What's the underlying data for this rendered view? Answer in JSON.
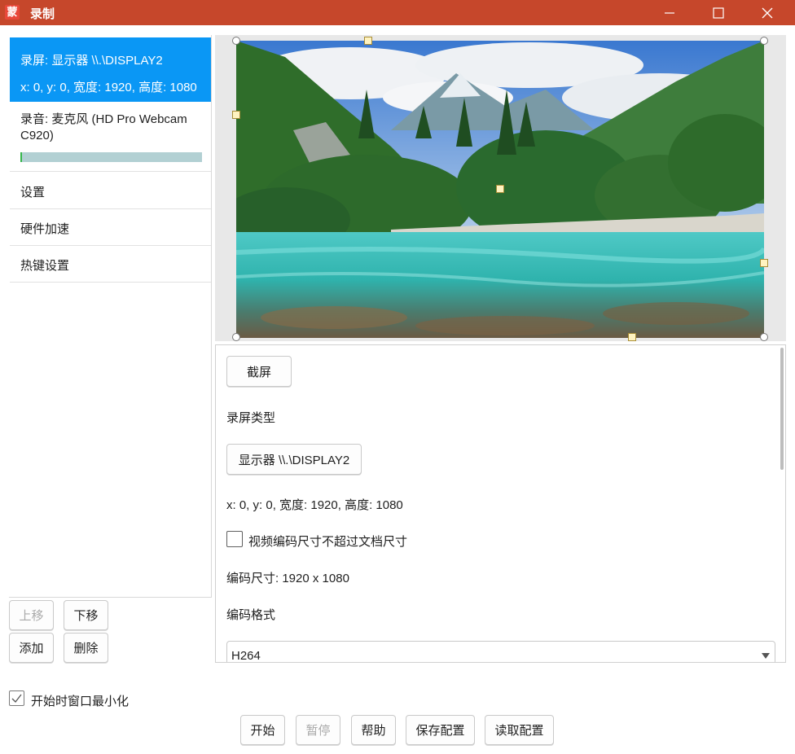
{
  "window": {
    "app_icon_glyph": "蒙",
    "title": "录制",
    "titlebar_color": "#c6472b"
  },
  "sources": {
    "screen_line1": "录屏: 显示器 \\\\.\\DISPLAY2",
    "screen_line2": "x: 0, y: 0, 宽度: 1920, 高度: 1080",
    "audio_label": "录音: 麦克风 (HD Pro Webcam C920)",
    "audio_level_fraction": 0.01,
    "selected_color": "#0a97f5"
  },
  "menu": {
    "settings": "设置",
    "hw_accel": "硬件加速",
    "hotkeys": "热键设置"
  },
  "list_buttons": {
    "move_up": "上移",
    "move_down": "下移",
    "add": "添加",
    "delete": "删除"
  },
  "panel": {
    "screenshot_button": "截屏",
    "record_type_label": "录屏类型",
    "display_button": "显示器 \\\\.\\DISPLAY2",
    "region_text": "x: 0, y: 0, 宽度: 1920, 高度: 1080",
    "limit_size_checkbox": "视频编码尺寸不超过文档尺寸",
    "encode_size_text": "编码尺寸: 1920 x 1080",
    "encode_format_label": "编码格式",
    "encode_format_value": "H264"
  },
  "footer": {
    "minimize_on_start": "开始时窗口最小化",
    "minimize_on_start_checked": true,
    "start": "开始",
    "pause": "暂停",
    "help": "帮助",
    "save_config": "保存配置",
    "load_config": "读取配置"
  }
}
